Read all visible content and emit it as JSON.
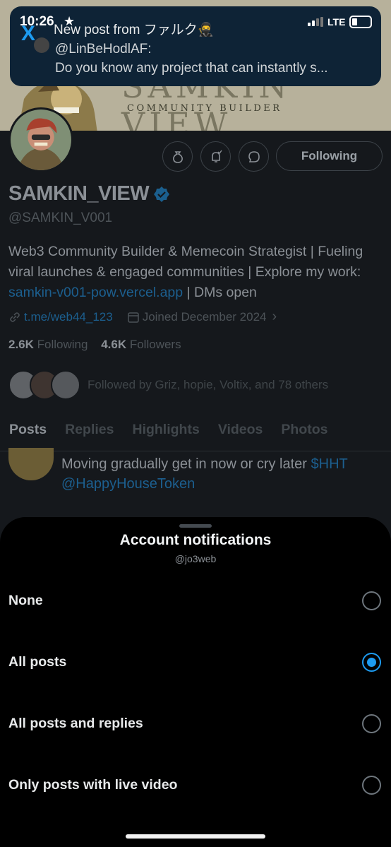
{
  "status_bar": {
    "time": "10:26",
    "network": "LTE"
  },
  "notification": {
    "title": "New post from ファルク🥷",
    "handle": "@LinBeHodlAF:",
    "preview": "Do you know any project that can instantly s..."
  },
  "banner": {
    "title": "SAMKIN VIEW",
    "subtitle": "COMMUNITY BUILDER"
  },
  "profile": {
    "following_button": "Following",
    "name": "SAMKIN_VIEW",
    "handle": "@SAMKIN_V001",
    "bio_text": "Web3 Community Builder & Memecoin Strategist | Fueling viral launches & engaged communities | Explore my work: ",
    "bio_link": "samkin-v001-pow.vercel.app",
    "bio_tail": " | DMs open",
    "website": "t.me/web44_123",
    "joined": "Joined December 2024",
    "joined_chevron": "›",
    "following_count": "2.6K",
    "following_label": " Following",
    "followers_count": "4.6K",
    "followers_label": " Followers",
    "followed_by": "Followed by Griz, hopie, Voltix, and 78 others",
    "colors": {
      "accent": "#1d9bf0",
      "verified": "#1d9bf0"
    }
  },
  "tabs": [
    {
      "label": "Posts",
      "active": true
    },
    {
      "label": "Replies"
    },
    {
      "label": "Highlights"
    },
    {
      "label": "Videos"
    },
    {
      "label": "Photos"
    }
  ],
  "post": {
    "text": "Moving gradually get in now or cry later ",
    "cashtag": "$HHT",
    "mention": "@HappyHouseToken"
  },
  "sheet": {
    "title": "Account notifications",
    "subtitle": "@jo3web",
    "options": [
      {
        "label": "None",
        "selected": false
      },
      {
        "label": "All posts",
        "selected": true
      },
      {
        "label": "All posts and replies",
        "selected": false
      },
      {
        "label": "Only posts with live video",
        "selected": false
      }
    ]
  }
}
